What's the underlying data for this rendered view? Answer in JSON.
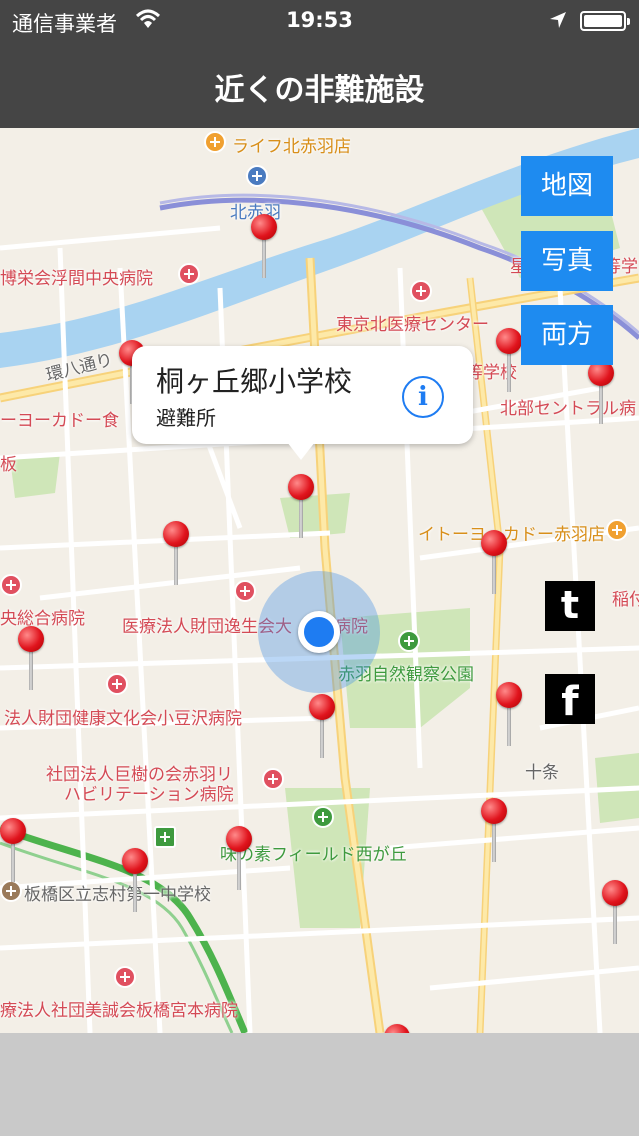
{
  "status": {
    "carrier": "通信事業者",
    "time": "19:53"
  },
  "nav": {
    "title": "近くの非難施設"
  },
  "callout": {
    "title": "桐ヶ丘郷小学校",
    "subtitle": "避難所",
    "info_icon": "i"
  },
  "buttons": {
    "map": "地図",
    "photo": "写真",
    "both": "両方"
  },
  "social": {
    "twitter": "t",
    "facebook": "f"
  },
  "map_labels": {
    "life": "ライフ北赤羽店",
    "kitaakabane": "北赤羽",
    "hakueikai": "博栄会浮間中央病院",
    "tokyokita": "東京北医療センター",
    "kanpachi": "環八通り",
    "itoyokado_left": "ーヨーカドー食",
    "hokubu": "北部セントラル病",
    "gakkou": "等学校",
    "gakkou2": "星",
    "gakkou3": "等学",
    "ita": "板",
    "itoyokado_akabane": "イトーヨーカドー赤羽店",
    "inada": "稲付",
    "sogo": "央総合病院",
    "issei": "医療法人財団逸生会大",
    "byoin": "病院",
    "akabane_park": "赤羽自然観察公園",
    "kenko": "法人財団健康文化会小豆沢病院",
    "kyoju1": "社団法人巨樹の会赤羽リ",
    "kyoju2": "ハビリテーション病院",
    "jujo": "十条",
    "ajinomoto": "味の素フィールド西が丘",
    "shimura": "板橋区立志村第一中学校",
    "bisei": "療法人社団美誠会板橋宮本病院"
  }
}
